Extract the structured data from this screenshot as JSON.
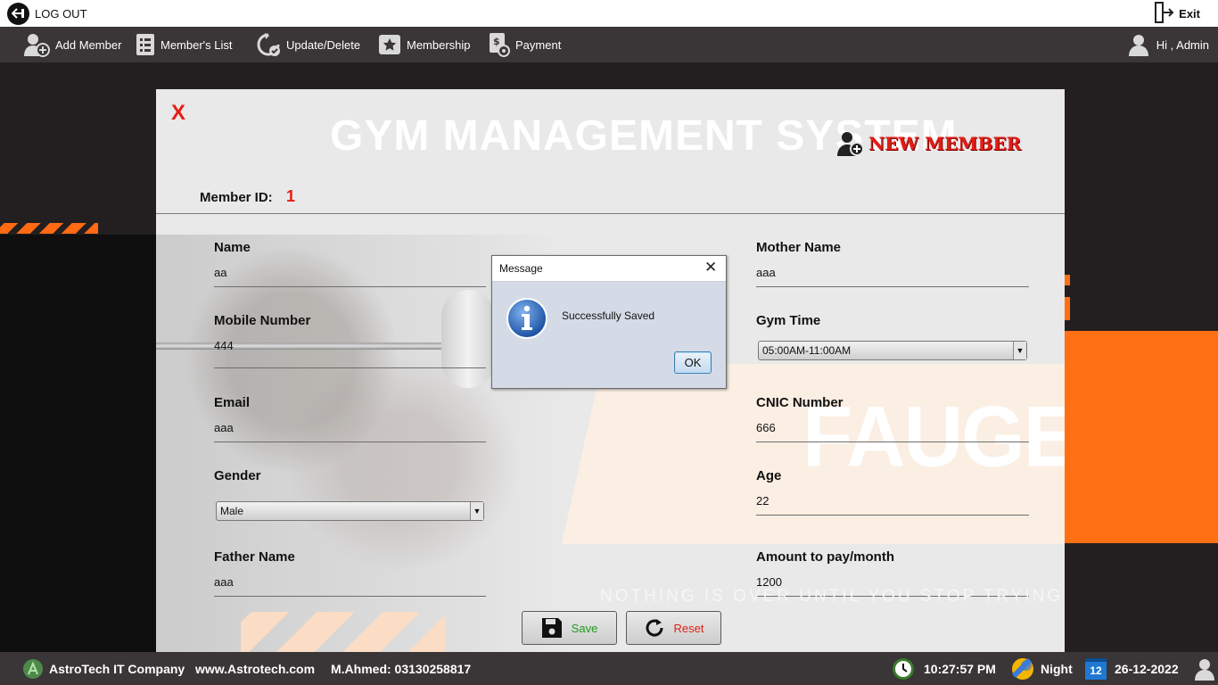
{
  "topbar": {
    "logout_label": "LOG OUT",
    "exit_label": "Exit"
  },
  "menu": {
    "add_member": "Add Member",
    "members_list": "Member's List",
    "update_delete": "Update/Delete",
    "membership": "Membership",
    "payment": "Payment",
    "greeting": "Hi , Admin"
  },
  "form": {
    "close_label": "X",
    "app_title": "GYM MANAGEMENT SYSTEM",
    "section_title": "NEW MEMBER",
    "member_id_label": "Member ID:",
    "member_id_value": "1",
    "fields": {
      "name": {
        "label": "Name",
        "value": "aa"
      },
      "mobile": {
        "label": "Mobile Number",
        "value": "444"
      },
      "email": {
        "label": "Email",
        "value": "aaa"
      },
      "gender": {
        "label": "Gender",
        "value": "Male"
      },
      "father_name": {
        "label": "Father Name",
        "value": "aaa"
      },
      "mother_name": {
        "label": "Mother Name",
        "value": "aaa"
      },
      "gym_time": {
        "label": "Gym Time",
        "value": "05:00AM-11:00AM"
      },
      "cnic": {
        "label": "CNIC Number",
        "value": "666"
      },
      "age": {
        "label": "Age",
        "value": "22"
      },
      "amount": {
        "label": "Amount to pay/month",
        "value": "1200"
      }
    },
    "brand_word": "FAUGET",
    "motto": "NOTHING IS OVER UNTIL YOU STOP TRYING",
    "save_label": "Save",
    "reset_label": "Reset"
  },
  "dialog": {
    "title": "Message",
    "close_glyph": "✕",
    "message": "Successfully Saved",
    "ok_label": "OK"
  },
  "statusbar": {
    "company": "AstroTech IT Company",
    "website": "www.Astrotech.com",
    "contact": "M.Ahmed: 03130258817",
    "time": "10:27:57 PM",
    "period": "Night",
    "calendar_day": "12",
    "date": "26-12-2022"
  },
  "colors": {
    "accent_orange": "#ff6f14",
    "alert_red": "#e21e16",
    "bar_dark": "#3a3536",
    "save_green": "#1f9a1f",
    "reset_red": "#e21e16"
  }
}
